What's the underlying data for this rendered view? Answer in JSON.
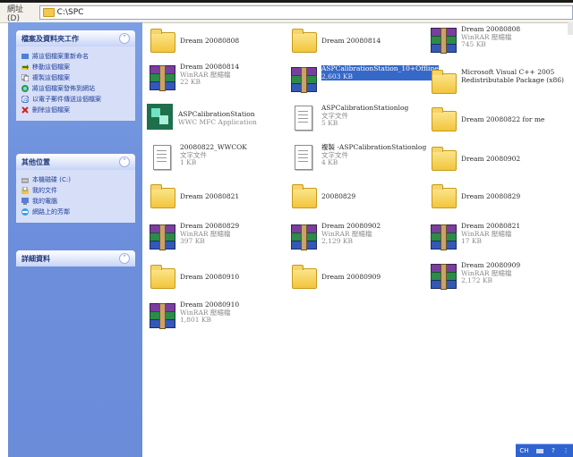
{
  "address": {
    "label": "網址(D)",
    "path": "C:\\SPC"
  },
  "taskpane": {
    "file_tasks": {
      "title": "檔案及資料夾工作",
      "items": [
        {
          "label": "將這個檔案重新命名",
          "icon": "rename-icon"
        },
        {
          "label": "移動這個檔案",
          "icon": "move-icon"
        },
        {
          "label": "複製這個檔案",
          "icon": "copy-icon"
        },
        {
          "label": "將這個檔案發佈到網站",
          "icon": "publish-web-icon"
        },
        {
          "label": "以電子郵件傳送這個檔案",
          "icon": "email-icon"
        },
        {
          "label": "刪除這個檔案",
          "icon": "delete-icon"
        }
      ]
    },
    "other_places": {
      "title": "其他位置",
      "items": [
        {
          "label": "本機磁碟 (C:)",
          "icon": "drive-icon"
        },
        {
          "label": "我的文件",
          "icon": "my-documents-icon"
        },
        {
          "label": "我的電腦",
          "icon": "my-computer-icon"
        },
        {
          "label": "網路上的芳鄰",
          "icon": "network-places-icon"
        }
      ]
    },
    "details": {
      "title": "詳細資料"
    }
  },
  "files": [
    {
      "name": "Dream 20080808",
      "type": "",
      "size": "",
      "icon": "folder-icon"
    },
    {
      "name": "Dream 20080814",
      "type": "",
      "size": "",
      "icon": "folder-icon"
    },
    {
      "name": "Dream 20080808",
      "type": "WinRAR 壓縮檔",
      "size": "745 KB",
      "icon": "winrar-icon"
    },
    {
      "name": "Dream 20080814",
      "type": "WinRAR 壓縮檔",
      "size": "22 KB",
      "icon": "winrar-icon"
    },
    {
      "name": "ASPCalibrationStation_10+Offline",
      "type": "",
      "size": "2,603 KB",
      "icon": "winrar-icon",
      "selected": true
    },
    {
      "name": "Microsoft Visual C++ 2005 Redistributable Package (x86)",
      "type": "",
      "size": "",
      "icon": "folder-icon"
    },
    {
      "name": "ASPCalibrationStation",
      "type": "WWC MFC Application",
      "size": "",
      "icon": "app-icon"
    },
    {
      "name": "ASPCalibrationStationlog",
      "type": "文字文件",
      "size": "5 KB",
      "icon": "text-document-icon"
    },
    {
      "name": "Dream 20080822 for me",
      "type": "",
      "size": "",
      "icon": "folder-icon"
    },
    {
      "name": "20080822_WWCOK",
      "type": "文字文件",
      "size": "1 KB",
      "icon": "text-document-icon"
    },
    {
      "name": "複製 -ASPCalibrationStationlog",
      "type": "文字文件",
      "size": "4 KB",
      "icon": "text-document-icon"
    },
    {
      "name": "Dream 20080902",
      "type": "",
      "size": "",
      "icon": "folder-icon"
    },
    {
      "name": "Dream 20080821",
      "type": "",
      "size": "",
      "icon": "folder-icon"
    },
    {
      "name": "20080829",
      "type": "",
      "size": "",
      "icon": "folder-icon"
    },
    {
      "name": "Dream 20080829",
      "type": "",
      "size": "",
      "icon": "folder-icon"
    },
    {
      "name": "Dream 20080829",
      "type": "WinRAR 壓縮檔",
      "size": "397 KB",
      "icon": "winrar-icon"
    },
    {
      "name": "Dream 20080902",
      "type": "WinRAR 壓縮檔",
      "size": "2,129 KB",
      "icon": "winrar-icon"
    },
    {
      "name": "Dream 20080821",
      "type": "WinRAR 壓縮檔",
      "size": "17 KB",
      "icon": "winrar-icon"
    },
    {
      "name": "Dream 20080910",
      "type": "",
      "size": "",
      "icon": "folder-icon"
    },
    {
      "name": "Dream 20080909",
      "type": "",
      "size": "",
      "icon": "folder-icon"
    },
    {
      "name": "Dream 20080909",
      "type": "WinRAR 壓縮檔",
      "size": "2,172 KB",
      "icon": "winrar-icon"
    },
    {
      "name": "Dream 20080910",
      "type": "WinRAR 壓縮檔",
      "size": "1,801 KB",
      "icon": "winrar-icon"
    }
  ],
  "tray": {
    "lang": "CH",
    "help": "?"
  }
}
